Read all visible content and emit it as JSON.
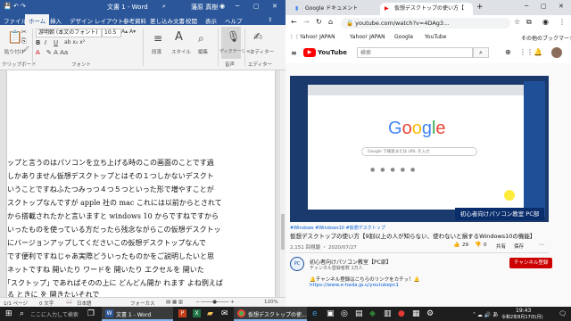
{
  "word": {
    "title": "文書 1 - Word",
    "user": "藩原 真樹",
    "tabs": [
      "ファイル",
      "ホーム",
      "挿入",
      "デザイン",
      "レイアウト",
      "参考資料",
      "差し込み文書",
      "校閲",
      "表示",
      "ヘルプ"
    ],
    "active_tab": "ホーム",
    "ribbon": {
      "paste": "貼り付け",
      "font_name": "游明朝 (本文のフォント)",
      "font_size": "10.5",
      "paragraph": "段落",
      "styles": "スタイル",
      "editing": "編集",
      "dictate": "ディクテーション",
      "editor": "エディター",
      "group_clipboard": "クリップボード",
      "group_font": "フォント",
      "group_voice": "音声",
      "group_editor": "エディター"
    },
    "doc_lines": [
      "ップと言うのはパソコンを立ち上げる時のこの画面のことです過",
      "しかありません仮想デスクトップとはその１つしかないデスクト",
      "いうことですねふたつみっつ４つ５つといった形で増やすことが",
      "スクトップなんですが apple 社の mac これには以前からとされて",
      "から搭載されたかと言いますと windows 10 からですねですから",
      "いったものを使っている方だったら残念ながらこの仮想デスクトッ",
      "にバージョンアップしてくださいこの仮想デスクトップなんで",
      "です便利ですねじゃあ実際どういったものかをご説明したいと思",
      "ネットですね 開いたり ワードを 開いたり エクセルを 開いた",
      "｢スクトップ｣ であればそのの上に どんどん開か れます よね例えば",
      "る ときに を 開きたいそれで"
    ],
    "status": {
      "page": "1/1 ページ",
      "words": "0 文字",
      "lang": "日本語",
      "focus": "フォーカス",
      "zoom": "120%"
    }
  },
  "chrome": {
    "tabs": [
      {
        "label": "Google ドキュメント",
        "active": false
      },
      {
        "label": "仮想デスクトップの使い方【",
        "active": true
      }
    ],
    "url": "youtube.com/watch?v=4DAg3...",
    "bookmarks": [
      "Yahoo! JAPAN",
      "Yahoo! JAPAN",
      "Google",
      "YouTube",
      "その他のブックマーク"
    ],
    "youtube": {
      "logo": "YouTube",
      "search_placeholder": "検索",
      "hashtags": "#Windows #Windows10 #仮想デスクトップ",
      "video_title": "仮想デスクトップの使い方【9割以上の人が知らない、使わないと損するWindows10の機能】",
      "meta": "2,151 回視聴 ・ 2020/07/27",
      "likes": "29",
      "dislikes": "0",
      "share_label": "共有",
      "save_label": "保存",
      "channel_name": "初心者向けパソコン教室【PC部】",
      "subscribers": "チャンネル登録者数 1万人",
      "subscribe_label": "チャンネル登録",
      "desc_line1": "🔔チャンネル登録はこちらのリンクをカチッ！🔔",
      "desc_line2": "https://www.e-hada.jp.u/youtubepc1",
      "video_banner": "初心者向けパソコン教室 PC部",
      "video_search_placeholder": "Google で検索または URL を入力"
    }
  },
  "taskbar": {
    "search_placeholder": "ここに入力して検索",
    "word_app": "文書 1 - Word",
    "chrome_app": "仮想デスクトップの使...",
    "time": "19:43",
    "date": "令和2年8月17日(月)"
  },
  "colors": {
    "word_blue": "#2b579a",
    "youtube_red": "#ff0000",
    "taskbar": "#1e1e1e"
  }
}
